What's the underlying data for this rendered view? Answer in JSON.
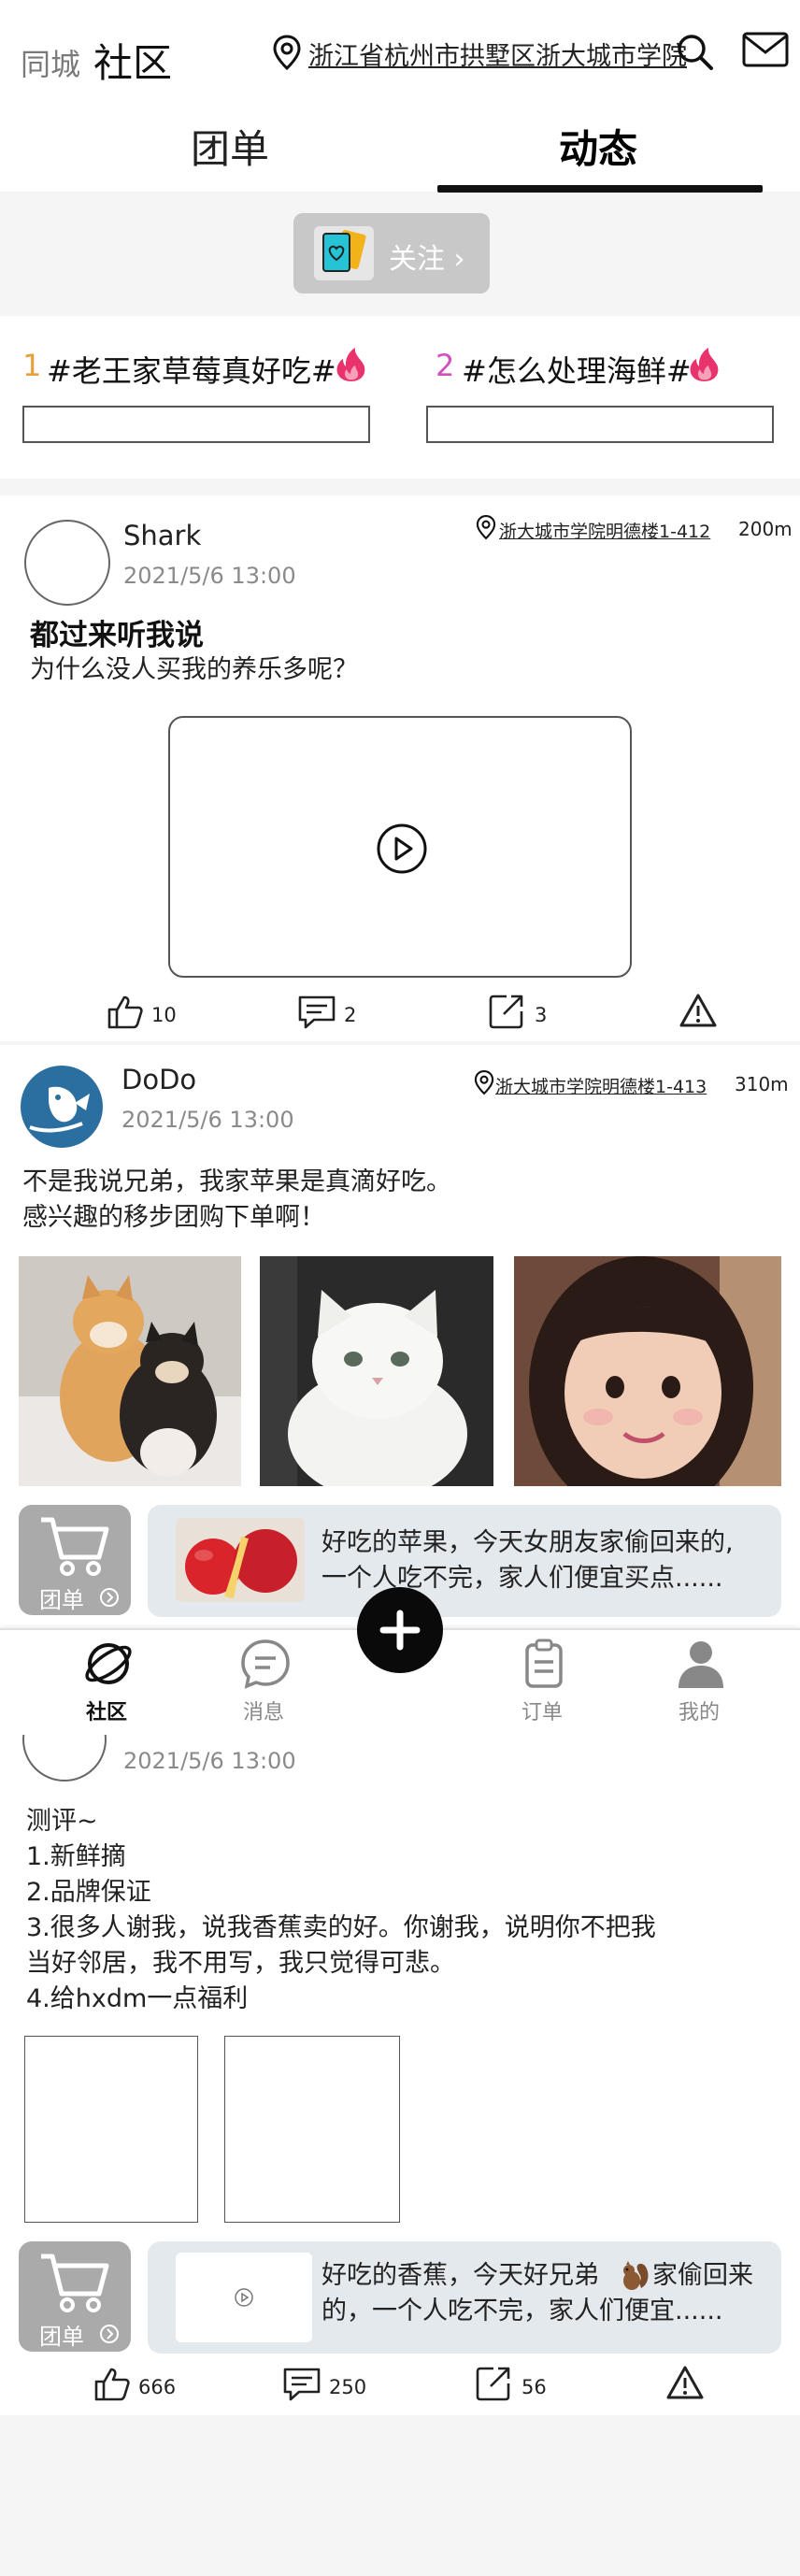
{
  "header": {
    "city_label": "同城",
    "title": "社区",
    "location": "浙江省杭州市拱墅区浙大城市学院",
    "tabs": [
      {
        "label": "团单",
        "active": false
      },
      {
        "label": "动态",
        "active": true
      }
    ]
  },
  "follow": {
    "label": "关注 ›"
  },
  "topics": [
    {
      "rank": "1",
      "rank_color": "#e8a03a",
      "text": "#老王家草莓真好吃#"
    },
    {
      "rank": "2",
      "rank_color": "#d24fc0",
      "text": "#怎么处理海鲜#"
    }
  ],
  "posts": [
    {
      "author": "Shark",
      "time": "2021/5/6  13:00",
      "address": "浙大城市学院明德楼1-412",
      "distance": "200m",
      "title": "都过来听我说",
      "text": "为什么没人买我的养乐多呢？",
      "likes": "10",
      "comments": "2",
      "shares": "3"
    },
    {
      "author": "DoDo",
      "time": "2021/5/6  13:00",
      "address": "浙大城市学院明德楼1-413",
      "distance": "310m",
      "text_lines": [
        "不是我说兄弟，我家苹果是真滴好吃。",
        "感兴趣的移步团购下单啊！"
      ],
      "photos": [
        "shiba-dogs-photo",
        "white-cat-photo",
        "girl-photo"
      ],
      "cart_label": "团单",
      "product_lines": [
        "好吃的苹果，今天女朋友家偷回来的,",
        "一个人吃不完，家人们便宜买点......"
      ]
    },
    {
      "time": "2021/5/6  13:00",
      "text_lines": [
        "测评~",
        "1.新鲜摘",
        "2.品牌保证",
        "3.很多人谢我，说我香蕉卖的好。你谢我，说明你不把我",
        "当好邻居，我不用写，我只觉得可悲。",
        "4.给hxdm一点福利"
      ],
      "cart_label": "团单",
      "product_lines": [
        "好吃的香蕉，今天好兄弟",
        "家偷回来",
        "的，一个人吃不完，家人们便宜......"
      ],
      "likes": "666",
      "comments": "250",
      "shares": "56"
    }
  ],
  "bottom_nav": [
    {
      "label": "社区",
      "icon": "planet-icon",
      "active": true
    },
    {
      "label": "消息",
      "icon": "message-icon",
      "active": false
    },
    {
      "label": "订单",
      "icon": "clipboard-icon",
      "active": false
    },
    {
      "label": "我的",
      "icon": "person-icon",
      "active": false
    }
  ],
  "colors": {
    "accent": "#111111",
    "heart": "#e8336d",
    "card_bg": "#e3e9ec",
    "cart_bg": "#aaaaaa"
  }
}
